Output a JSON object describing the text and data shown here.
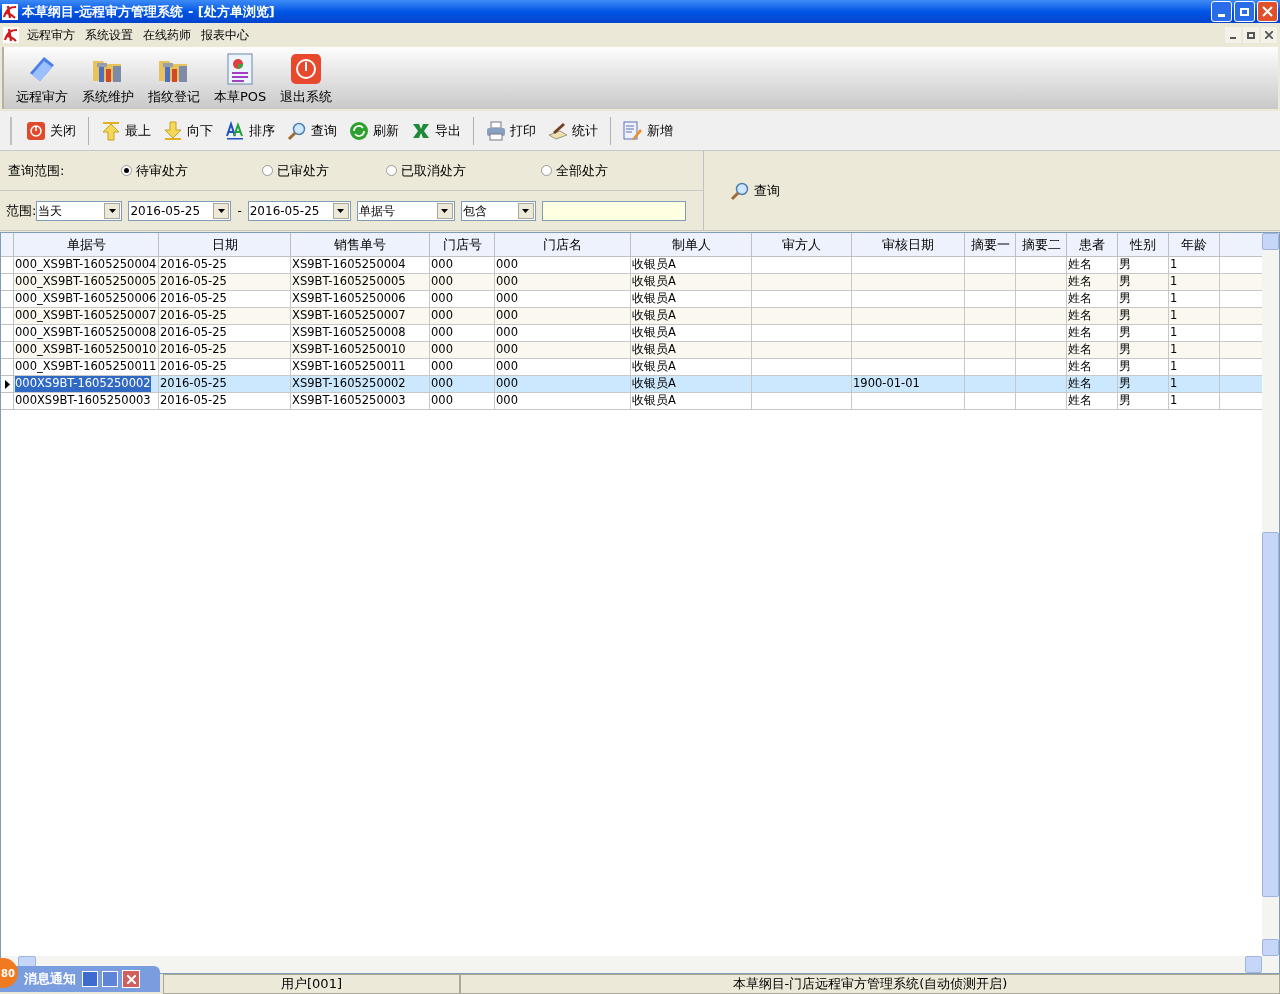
{
  "window": {
    "title": "本草纲目-远程审方管理系统 - [处方单浏览]"
  },
  "menu": [
    "远程审方",
    "系统设置",
    "在线药师",
    "报表中心"
  ],
  "main_toolbar": [
    "远程审方",
    "系统维护",
    "指纹登记",
    "本草POS",
    "退出系统"
  ],
  "toolbar": [
    {
      "label": "关闭",
      "kind": "power"
    },
    {
      "label": "最上",
      "kind": "up"
    },
    {
      "label": "向下",
      "kind": "down"
    },
    {
      "label": "排序",
      "kind": "sort"
    },
    {
      "label": "查询",
      "kind": "search"
    },
    {
      "label": "刷新",
      "kind": "refresh"
    },
    {
      "label": "导出",
      "kind": "excel"
    },
    {
      "label": "打印",
      "kind": "print"
    },
    {
      "label": "统计",
      "kind": "stats"
    },
    {
      "label": "新增",
      "kind": "add"
    }
  ],
  "filter": {
    "scope_label": "查询范围:",
    "options": [
      {
        "label": "待审处方",
        "selected": true
      },
      {
        "label": "已审处方",
        "selected": false
      },
      {
        "label": "已取消处方",
        "selected": false
      },
      {
        "label": "全部处方",
        "selected": false
      }
    ],
    "range_label": "范围:",
    "range": "当天",
    "date_from": "2016-05-25",
    "dash": "-",
    "date_to": "2016-05-25",
    "field": "单据号",
    "match": "包含",
    "search_button": "查询"
  },
  "table": {
    "columns": [
      "单据号",
      "日期",
      "销售单号",
      "门店号",
      "门店名",
      "制单人",
      "审方人",
      "审核日期",
      "摘要一",
      "摘要二",
      "患者",
      "性别",
      "年龄"
    ],
    "rows": [
      {
        "cells": [
          "000_XS9BT-1605250004",
          "2016-05-25",
          "XS9BT-1605250004",
          "000",
          "000",
          "收银员A",
          "",
          "",
          "",
          "",
          "姓名",
          "男",
          "1"
        ],
        "selected": false
      },
      {
        "cells": [
          "000_XS9BT-1605250005",
          "2016-05-25",
          "XS9BT-1605250005",
          "000",
          "000",
          "收银员A",
          "",
          "",
          "",
          "",
          "姓名",
          "男",
          "1"
        ],
        "selected": false
      },
      {
        "cells": [
          "000_XS9BT-1605250006",
          "2016-05-25",
          "XS9BT-1605250006",
          "000",
          "000",
          "收银员A",
          "",
          "",
          "",
          "",
          "姓名",
          "男",
          "1"
        ],
        "selected": false
      },
      {
        "cells": [
          "000_XS9BT-1605250007",
          "2016-05-25",
          "XS9BT-1605250007",
          "000",
          "000",
          "收银员A",
          "",
          "",
          "",
          "",
          "姓名",
          "男",
          "1"
        ],
        "selected": false
      },
      {
        "cells": [
          "000_XS9BT-1605250008",
          "2016-05-25",
          "XS9BT-1605250008",
          "000",
          "000",
          "收银员A",
          "",
          "",
          "",
          "",
          "姓名",
          "男",
          "1"
        ],
        "selected": false
      },
      {
        "cells": [
          "000_XS9BT-1605250010",
          "2016-05-25",
          "XS9BT-1605250010",
          "000",
          "000",
          "收银员A",
          "",
          "",
          "",
          "",
          "姓名",
          "男",
          "1"
        ],
        "selected": false
      },
      {
        "cells": [
          "000_XS9BT-1605250011",
          "2016-05-25",
          "XS9BT-1605250011",
          "000",
          "000",
          "收银员A",
          "",
          "",
          "",
          "",
          "姓名",
          "男",
          "1"
        ],
        "selected": false
      },
      {
        "cells": [
          "000XS9BT-1605250002",
          "2016-05-25",
          "XS9BT-1605250002",
          "000",
          "000",
          "收银员A",
          "",
          "1900-01-01",
          "",
          "",
          "姓名",
          "男",
          "1"
        ],
        "selected": true
      },
      {
        "cells": [
          "000XS9BT-1605250003",
          "2016-05-25",
          "XS9BT-1605250003",
          "000",
          "000",
          "收银员A",
          "",
          "",
          "",
          "",
          "姓名",
          "男",
          "1"
        ],
        "selected": false
      }
    ]
  },
  "notification": {
    "badge": "80",
    "title": "消息通知"
  },
  "status_bar": {
    "user": "用户[001]",
    "message": "本草纲目-门店远程审方管理系统(自动侦测开启)"
  }
}
